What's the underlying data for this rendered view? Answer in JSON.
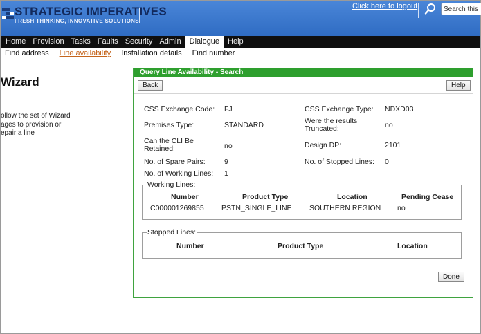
{
  "header": {
    "brand_title": "STRATEGIC IMPERATIVES",
    "brand_tagline": "FRESH THINKING, INNOVATIVE SOLUTIONS",
    "logout_label": "Click here to logout",
    "search_value": "Search this po"
  },
  "nav": {
    "items": [
      {
        "label": "Home"
      },
      {
        "label": "Provision"
      },
      {
        "label": "Tasks"
      },
      {
        "label": "Faults"
      },
      {
        "label": "Security"
      },
      {
        "label": "Admin"
      },
      {
        "label": "Dialogue"
      },
      {
        "label": "Help"
      }
    ],
    "active": "Dialogue"
  },
  "subnav": {
    "items": [
      {
        "label": "Find address"
      },
      {
        "label": "Line availability"
      },
      {
        "label": "Installation details"
      },
      {
        "label": "Find number"
      }
    ],
    "active": "Line availability"
  },
  "left": {
    "title": "Wizard",
    "text_lines": [
      "ollow the set of Wizard",
      "ages to provision or",
      "epair a line"
    ]
  },
  "panel": {
    "title": "Query Line Availability - Search",
    "back_label": "Back",
    "help_label": "Help",
    "done_label": "Done",
    "fields": {
      "css_exchange_code_label": "CSS Exchange Code:",
      "css_exchange_code_value": "FJ",
      "css_exchange_type_label": "CSS Exchange Type:",
      "css_exchange_type_value": "NDXD03",
      "premises_type_label": "Premises Type:",
      "premises_type_value": "STANDARD",
      "results_truncated_label_1": "Were the results",
      "results_truncated_label_2": "Truncated:",
      "results_truncated_value": "no",
      "cli_retained_label_1": "Can the CLI Be",
      "cli_retained_label_2": "Retained:",
      "cli_retained_value": "no",
      "design_dp_label": "Design DP:",
      "design_dp_value": "2101",
      "spare_pairs_label": "No. of Spare Pairs:",
      "spare_pairs_value": "9",
      "stopped_lines_count_label": "No. of Stopped Lines:",
      "stopped_lines_count_value": "0",
      "working_lines_count_label": "No. of Working Lines:",
      "working_lines_count_value": "1"
    },
    "working_lines": {
      "legend": "Working Lines:",
      "headers": [
        "Number",
        "Product Type",
        "Location",
        "Pending Cease"
      ],
      "rows": [
        [
          "C000001269855",
          "PSTN_SINGLE_LINE",
          "SOUTHERN REGION",
          "no"
        ]
      ]
    },
    "stopped_lines": {
      "legend": "Stopped Lines:",
      "headers": [
        "Number",
        "Product Type",
        "Location"
      ]
    }
  }
}
